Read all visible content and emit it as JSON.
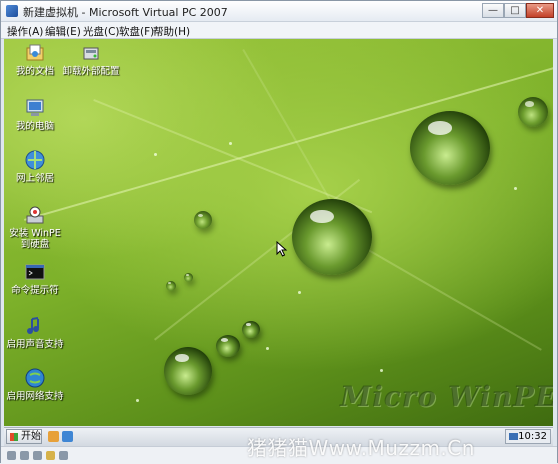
{
  "window": {
    "title": "新建虚拟机 - Microsoft Virtual PC 2007",
    "controls": [
      "—",
      "□",
      "✕"
    ]
  },
  "menu": [
    {
      "label": "操作(A)"
    },
    {
      "label": "编辑(E)"
    },
    {
      "label": "光盘(C)"
    },
    {
      "label": "软盘(F)"
    },
    {
      "label": "帮助(H)"
    }
  ],
  "desktop": {
    "icons": [
      {
        "label": "我的文档",
        "icon": "my-documents-icon"
      },
      {
        "label": "卸载外部配置",
        "icon": "uninstall-config-icon"
      },
      {
        "label": "我的电脑",
        "icon": "my-computer-icon"
      },
      {
        "label": "网上邻居",
        "icon": "network-places-icon"
      },
      {
        "label": "安装 WinPE 到硬盘",
        "icon": "install-winpe-icon"
      },
      {
        "label": "命令提示符",
        "icon": "command-prompt-icon"
      },
      {
        "label": "启用声音支持",
        "icon": "enable-sound-icon"
      },
      {
        "label": "启用网络支持",
        "icon": "enable-network-icon"
      }
    ],
    "watermark": "Micro WinPE"
  },
  "taskbar": {
    "start_label": "开始",
    "clock": "10:32"
  },
  "overlay_watermark": "猪猪猫Www.Muzzm.Cn"
}
